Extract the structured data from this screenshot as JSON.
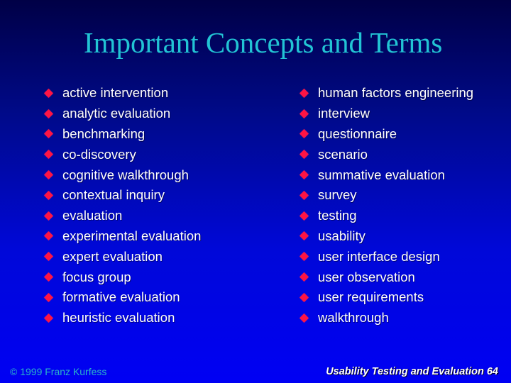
{
  "slide": {
    "title": "Important Concepts and Terms",
    "bullet_icon": "red-diamond-icon",
    "colors": {
      "title": "#22c4d4",
      "bullet": "#ff1444",
      "text": "#ffffff",
      "background_top": "#000046",
      "background_bottom": "#0000f4",
      "footer_left": "#2ab6c8"
    },
    "left_column": [
      "active intervention",
      "analytic evaluation",
      "benchmarking",
      "co-discovery",
      "cognitive walkthrough",
      "contextual inquiry",
      "evaluation",
      "experimental evaluation",
      "expert evaluation",
      "focus group",
      "formative evaluation",
      "heuristic evaluation"
    ],
    "right_column": [
      "human factors engineering",
      "interview",
      "questionnaire",
      "scenario",
      "summative evaluation",
      "survey",
      "testing",
      "usability",
      "user interface design",
      "user observation",
      "user requirements",
      "walkthrough"
    ]
  },
  "footer": {
    "copyright": "© 1999 Franz Kurfess",
    "course_and_page": "Usability Testing and Evaluation 64"
  }
}
